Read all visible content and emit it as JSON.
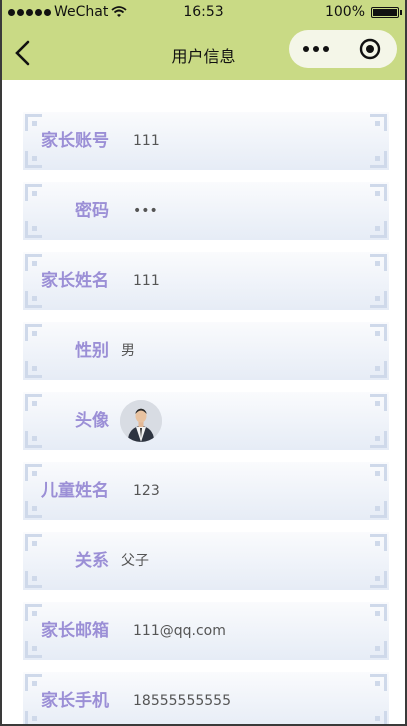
{
  "status_bar": {
    "carrier": "WeChat",
    "time": "16:53",
    "battery": "100%",
    "battery_level": 1.0
  },
  "nav": {
    "title": "用户信息"
  },
  "fields": [
    {
      "label": "家长账号",
      "value": "111"
    },
    {
      "label": "密码",
      "value": "•••"
    },
    {
      "label": "家长姓名",
      "value": "111"
    },
    {
      "label": "性别",
      "value": "男"
    },
    {
      "label": "头像",
      "value": ""
    },
    {
      "label": "儿童姓名",
      "value": "123"
    },
    {
      "label": "关系",
      "value": "父子"
    },
    {
      "label": "家长邮箱",
      "value": "111@qq.com"
    },
    {
      "label": "家长手机",
      "value": "18555555555"
    }
  ],
  "colors": {
    "header": "#c9da85",
    "label": "#9b8fd6",
    "row_top": "#fafbfd",
    "row_bottom": "#e6ecf6"
  }
}
